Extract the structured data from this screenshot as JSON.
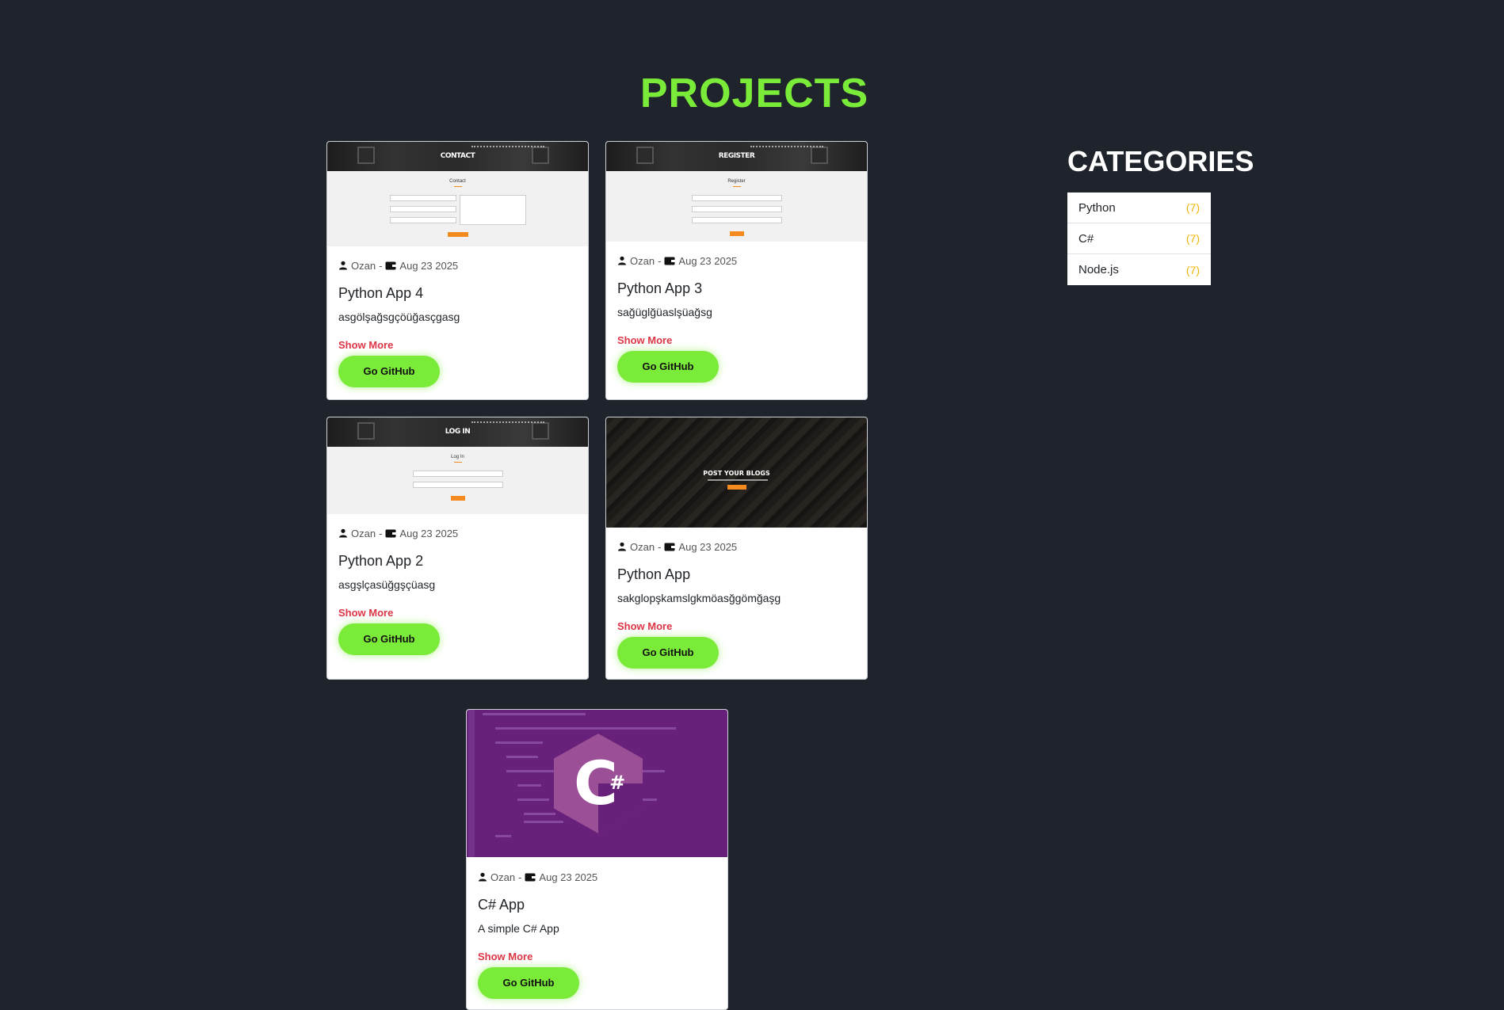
{
  "header": {
    "title": "PROJECTS"
  },
  "sidebar": {
    "title": "CATEGORIES",
    "items": [
      {
        "name": "Python",
        "count": "(7)"
      },
      {
        "name": "C#",
        "count": "(7)"
      },
      {
        "name": "Node.js",
        "count": "(7)"
      }
    ]
  },
  "projects": [
    {
      "author": "Ozan",
      "separator": "-",
      "date": "Aug 23 2025",
      "title": "Python App 4",
      "description": "asgölşağsgçöüğasçgasg",
      "show_more": "Show More",
      "github": "Go GitHub",
      "thumb": {
        "header": "CONTACT",
        "heading": "Contact"
      }
    },
    {
      "author": "Ozan",
      "separator": "-",
      "date": "Aug 23 2025",
      "title": "Python App 3",
      "description": "sağüglğüaslşüağsg",
      "show_more": "Show More",
      "github": "Go GitHub",
      "thumb": {
        "header": "REGISTER",
        "heading": "Register"
      }
    },
    {
      "author": "Ozan",
      "separator": "-",
      "date": "Aug 23 2025",
      "title": "Python App 2",
      "description": "asgşlçasüğgşçüasg",
      "show_more": "Show More",
      "github": "Go GitHub",
      "thumb": {
        "header": "LOG IN",
        "heading": "Log In"
      }
    },
    {
      "author": "Ozan",
      "separator": "-",
      "date": "Aug 23 2025",
      "title": "Python App",
      "description": "sakglopşkamslgkmöasğgömğaşg",
      "show_more": "Show More",
      "github": "Go GitHub",
      "thumb": {
        "header": "POST YOUR BLOGS"
      }
    },
    {
      "author": "Ozan",
      "separator": "-",
      "date": "Aug 23 2025",
      "title": "C# App",
      "description": "A simple C# App",
      "show_more": "Show More",
      "github": "Go GitHub",
      "thumb": {
        "logo_letter": "C",
        "logo_hash": "#"
      }
    }
  ],
  "colors": {
    "background": "#1f232c",
    "accent_green": "#7beb3a",
    "show_more_red": "#dc3545",
    "count_yellow": "#f0b400",
    "csharp_purple": "#68217a"
  },
  "icons": [
    "user-icon",
    "calendar-wallet-icon",
    "csharp-logo-icon"
  ]
}
